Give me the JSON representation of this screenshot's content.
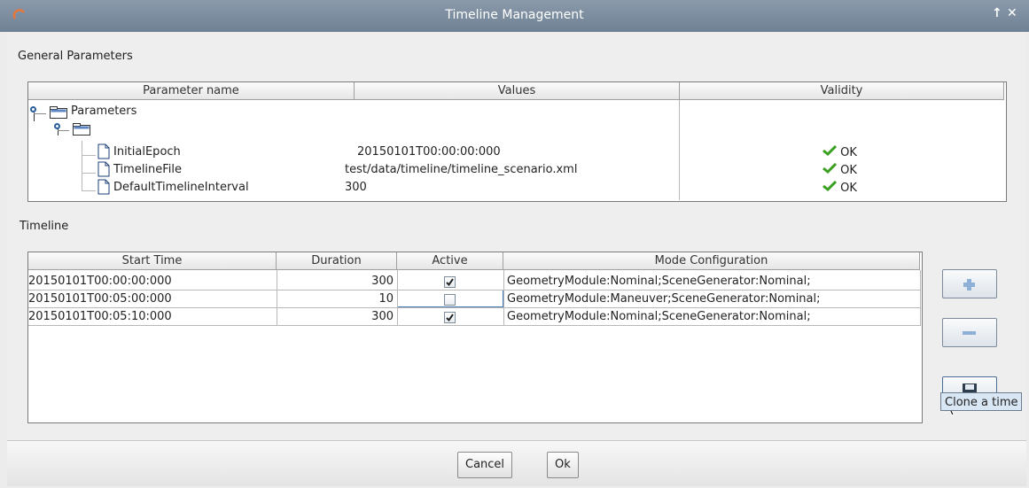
{
  "window": {
    "title": "Timeline Management",
    "controls": {
      "pin": "↑",
      "close": "✕"
    }
  },
  "general": {
    "label": "General Parameters",
    "columns": [
      "Parameter name",
      "Values",
      "Validity"
    ],
    "root": "Parameters",
    "rows": [
      {
        "name": "InitialEpoch",
        "value": "20150101T00:00:00:000",
        "validity": "OK"
      },
      {
        "name": "TimelineFile",
        "value": "test/data/timeline/timeline_scenario.xml",
        "validity": "OK"
      },
      {
        "name": "DefaultTimelineInterval",
        "value": "300",
        "validity": "OK"
      }
    ]
  },
  "timeline": {
    "label": "Timeline",
    "columns": [
      "Start Time",
      "Duration",
      "Active",
      "Mode Configuration"
    ],
    "rows": [
      {
        "start": "20150101T00:00:00:000",
        "duration": "300",
        "active": true,
        "mode": "GeometryModule:Nominal;SceneGenerator:Nominal;"
      },
      {
        "start": "20150101T00:05:00:000",
        "duration": "10",
        "active": false,
        "mode": "GeometryModule:Maneuver;SceneGenerator:Nominal;"
      },
      {
        "start": "20150101T00:05:10:000",
        "duration": "300",
        "active": true,
        "mode": "GeometryModule:Nominal;SceneGenerator:Nominal;"
      }
    ],
    "buttons": {
      "add_icon": "plus-icon",
      "remove_icon": "minus-icon",
      "clone_icon": "save-icon"
    },
    "tooltip": "Clone a time"
  },
  "footer": {
    "cancel": "Cancel",
    "ok": "Ok"
  },
  "colors": {
    "titlebar": "#7a8b9e",
    "ok_check": "#3aa021",
    "accent": "#4a7bb7"
  }
}
